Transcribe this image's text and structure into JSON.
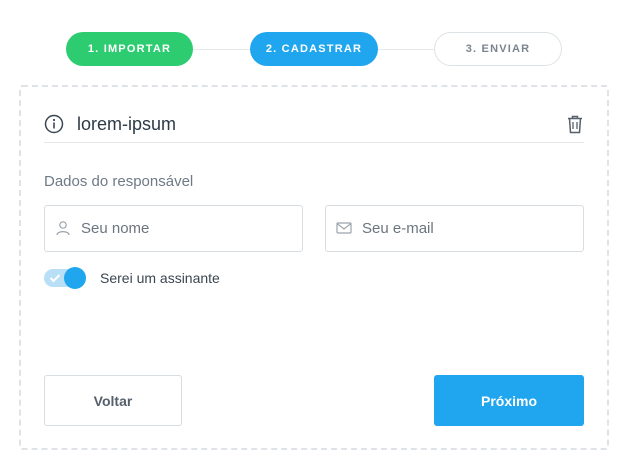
{
  "stepper": {
    "steps": [
      {
        "label": "1. IMPORTAR",
        "state": "done"
      },
      {
        "label": "2. CADASTRAR",
        "state": "active"
      },
      {
        "label": "3. ENVIAR",
        "state": "pending"
      }
    ]
  },
  "file": {
    "name": "lorem-ipsum",
    "info_icon": "info-circle-icon",
    "delete_icon": "trash-icon"
  },
  "form": {
    "section_label": "Dados do responsável",
    "name_field": {
      "placeholder": "Seu nome",
      "value": "",
      "icon": "user-icon"
    },
    "email_field": {
      "placeholder": "Seu e-mail",
      "value": "",
      "icon": "envelope-icon"
    },
    "subscriber_toggle": {
      "label": "Serei um assinante",
      "checked": true
    }
  },
  "actions": {
    "back_label": "Voltar",
    "next_label": "Próximo"
  },
  "colors": {
    "step_done": "#2ecc71",
    "primary": "#1fa6ee",
    "border": "#d8dde2",
    "text": "#2c3a46"
  }
}
